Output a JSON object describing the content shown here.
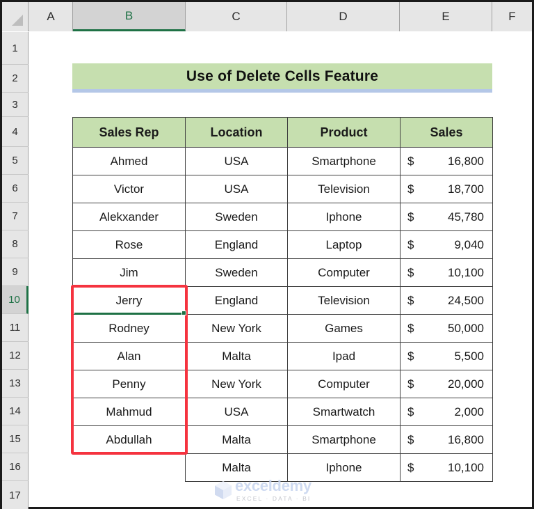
{
  "spreadsheet": {
    "column_headers": [
      "A",
      "B",
      "C",
      "D",
      "E",
      "F"
    ],
    "selected_column": "B",
    "row_headers": [
      "1",
      "2",
      "3",
      "4",
      "5",
      "6",
      "7",
      "8",
      "9",
      "10",
      "11",
      "12",
      "13",
      "14",
      "15",
      "16",
      "17"
    ],
    "selected_row": "10",
    "active_cell": "B10",
    "select_all_icon": "select-all-triangle-icon"
  },
  "title": {
    "text": "Use of Delete Cells Feature",
    "fill_color": "#C6DFAF",
    "underline_color": "#B4C7E7"
  },
  "table": {
    "headers": [
      "Sales Rep",
      "Location",
      "Product",
      "Sales"
    ],
    "header_fill": "#C6DFAF",
    "currency_symbol": "$",
    "rows": [
      {
        "sales_rep": "Ahmed",
        "location": "USA",
        "product": "Smartphone",
        "sales": "16,800"
      },
      {
        "sales_rep": "Victor",
        "location": "USA",
        "product": "Television",
        "sales": "18,700"
      },
      {
        "sales_rep": "Alekxander",
        "location": "Sweden",
        "product": "Iphone",
        "sales": "45,780"
      },
      {
        "sales_rep": "Rose",
        "location": "England",
        "product": "Laptop",
        "sales": "9,040"
      },
      {
        "sales_rep": "Jim",
        "location": "Sweden",
        "product": "Computer",
        "sales": "10,100"
      },
      {
        "sales_rep": "Jerry",
        "location": "England",
        "product": "Television",
        "sales": "24,500"
      },
      {
        "sales_rep": "Rodney",
        "location": "New York",
        "product": "Games",
        "sales": "50,000"
      },
      {
        "sales_rep": "Alan",
        "location": "Malta",
        "product": "Ipad",
        "sales": "5,500"
      },
      {
        "sales_rep": "Penny",
        "location": "New York",
        "product": "Computer",
        "sales": "20,000"
      },
      {
        "sales_rep": "Mahmud",
        "location": "USA",
        "product": "Smartwatch",
        "sales": "2,000"
      },
      {
        "sales_rep": "Abdullah",
        "location": "Malta",
        "product": "Smartphone",
        "sales": "16,800"
      },
      {
        "sales_rep": "",
        "location": "Malta",
        "product": "Iphone",
        "sales": "10,100"
      }
    ]
  },
  "annotation": {
    "highlight_color": "#F5333F",
    "selection_color": "#1E7145"
  },
  "watermark": {
    "name": "exceldemy",
    "tagline": "EXCEL · DATA · BI"
  }
}
